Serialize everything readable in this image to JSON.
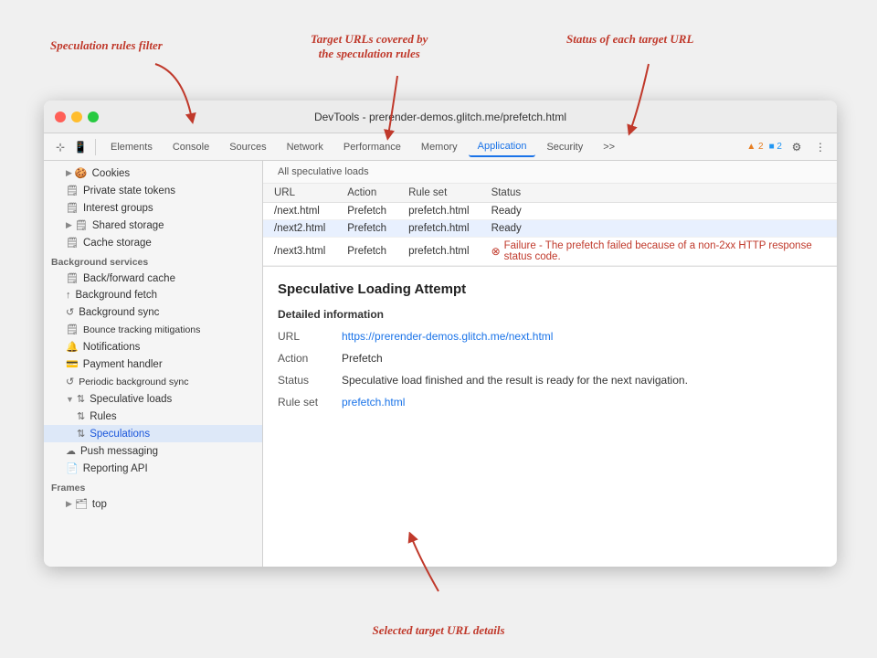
{
  "annotations": {
    "speculation_filter": "Speculation rules filter",
    "target_urls": "Target URLs covered by\nthe speculation rules",
    "status_each": "Status of each target URL",
    "selected_details": "Selected target URL details"
  },
  "window": {
    "title": "DevTools - prerender-demos.glitch.me/prefetch.html"
  },
  "toolbar": {
    "tabs": [
      {
        "label": "Elements",
        "active": false
      },
      {
        "label": "Console",
        "active": false
      },
      {
        "label": "Sources",
        "active": false
      },
      {
        "label": "Network",
        "active": false
      },
      {
        "label": "Performance",
        "active": false
      },
      {
        "label": "Memory",
        "active": false
      },
      {
        "label": "Application",
        "active": true
      },
      {
        "label": "Security",
        "active": false
      },
      {
        "label": ">>",
        "active": false
      }
    ],
    "badge_warn": "▲ 2",
    "badge_err": "■ 2"
  },
  "sidebar": {
    "sections": [
      {
        "items": [
          {
            "label": "Cookies",
            "icon": "▶ 🍪",
            "indent": 1,
            "expandable": true
          },
          {
            "label": "Private state tokens",
            "icon": "🗒",
            "indent": 1
          },
          {
            "label": "Interest groups",
            "icon": "🗒",
            "indent": 1
          },
          {
            "label": "Shared storage",
            "icon": "▶ 🗒",
            "indent": 1,
            "expandable": true
          },
          {
            "label": "Cache storage",
            "icon": "🗒",
            "indent": 1
          }
        ]
      },
      {
        "group_label": "Background services",
        "items": [
          {
            "label": "Back/forward cache",
            "icon": "🗒",
            "indent": 1
          },
          {
            "label": "Background fetch",
            "icon": "↑",
            "indent": 1
          },
          {
            "label": "Background sync",
            "icon": "↺",
            "indent": 1
          },
          {
            "label": "Bounce tracking mitigations",
            "icon": "🗒",
            "indent": 1
          },
          {
            "label": "Notifications",
            "icon": "🔔",
            "indent": 1
          },
          {
            "label": "Payment handler",
            "icon": "💳",
            "indent": 1
          },
          {
            "label": "Periodic background sync",
            "icon": "↺",
            "indent": 1
          },
          {
            "label": "Speculative loads",
            "icon": "▼ ↑↓",
            "indent": 1,
            "expanded": true
          },
          {
            "label": "Rules",
            "icon": "↑↓",
            "indent": 2
          },
          {
            "label": "Speculations",
            "icon": "↑↓",
            "indent": 2,
            "selected": true
          },
          {
            "label": "Push messaging",
            "icon": "☁",
            "indent": 1
          },
          {
            "label": "Reporting API",
            "icon": "📄",
            "indent": 1
          }
        ]
      },
      {
        "group_label": "Frames",
        "items": [
          {
            "label": "top",
            "icon": "▶ 🗂",
            "indent": 1,
            "expandable": true
          }
        ]
      }
    ]
  },
  "table": {
    "section_header": "All speculative loads",
    "columns": [
      "URL",
      "Action",
      "Rule set",
      "Status"
    ],
    "rows": [
      {
        "url": "/next.html",
        "action": "Prefetch",
        "rule_set": "prefetch.html",
        "status": "Ready",
        "error": false,
        "selected": false
      },
      {
        "url": "/next2.html",
        "action": "Prefetch",
        "rule_set": "prefetch.html",
        "status": "Ready",
        "error": false,
        "selected": true
      },
      {
        "url": "/next3.html",
        "action": "Prefetch",
        "rule_set": "prefetch.html",
        "status": "Failure - The prefetch failed because of a non-2xx HTTP response status code.",
        "error": true,
        "selected": false
      }
    ]
  },
  "detail": {
    "title": "Speculative Loading Attempt",
    "section_label": "Detailed information",
    "url_label": "URL",
    "url_value": "https://prerender-demos.glitch.me/next.html",
    "action_label": "Action",
    "action_value": "Prefetch",
    "status_label": "Status",
    "status_value": "Speculative load finished and the result is ready for the next navigation.",
    "rule_set_label": "Rule set",
    "rule_set_value": "prefetch.html"
  }
}
